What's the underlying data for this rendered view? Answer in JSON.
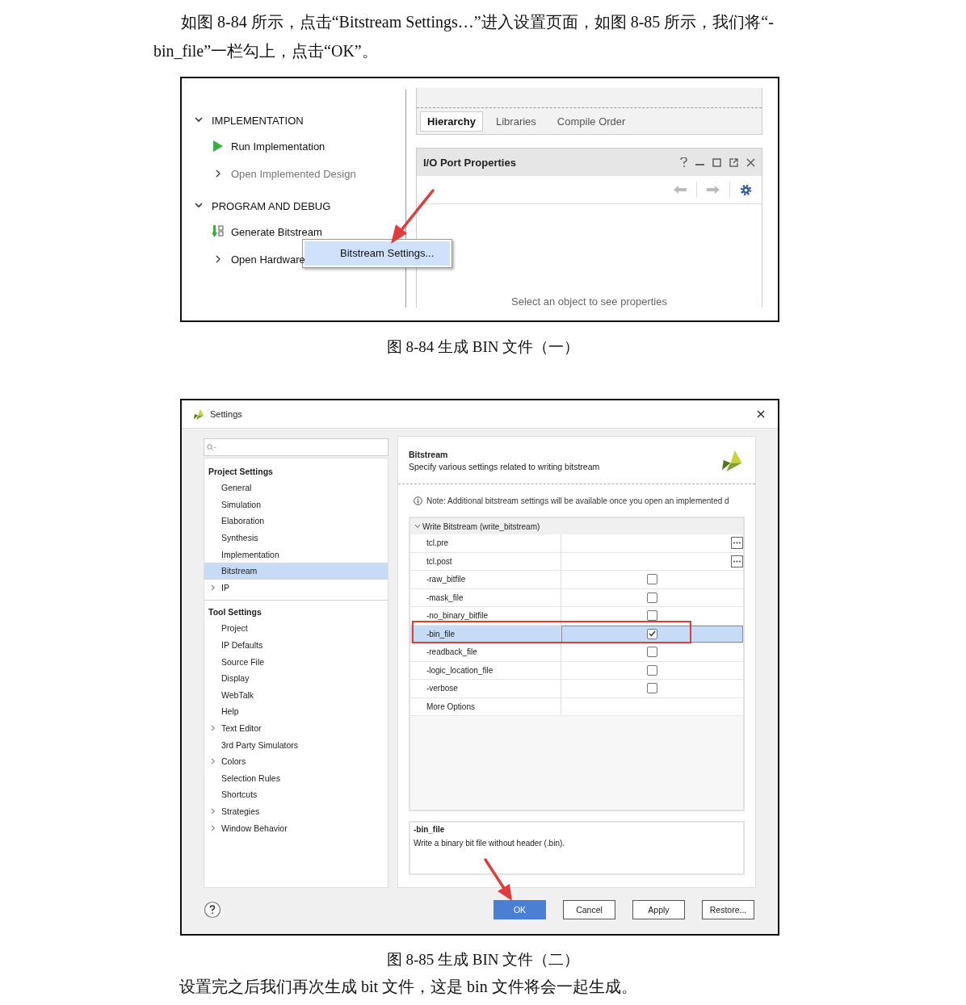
{
  "intro_paragraph": "如图 8-84 所示，点击“Bitstream Settings…”进入设置页面，如图 8-85 所示，我们将“-bin_file”一栏勾上，点击“OK”。",
  "figure_1": {
    "flow_navigator": [
      {
        "title": "IMPLEMENTATION",
        "expanded": true,
        "items": [
          {
            "kind": "run",
            "label": "Run Implementation",
            "disabled": false
          },
          {
            "kind": "open",
            "label": "Open Implemented Design",
            "disabled": true
          }
        ]
      },
      {
        "title": "PROGRAM AND DEBUG",
        "expanded": true,
        "items": [
          {
            "kind": "bitstream",
            "label": "Generate Bitstream",
            "disabled": false
          },
          {
            "kind": "open",
            "label": "Open Hardware",
            "disabled": false
          }
        ]
      }
    ],
    "context_menu": [
      {
        "label": "Bitstream Settings...",
        "selected": true
      }
    ],
    "source_tabs": [
      {
        "label": "Hierarchy",
        "selected": true
      },
      {
        "label": "Libraries",
        "selected": false
      },
      {
        "label": "Compile Order",
        "selected": false
      }
    ],
    "properties_panel": {
      "title": "I/O Port Properties",
      "empty_message": "Select an object to see properties"
    }
  },
  "figure_1_caption": "图 8-84  生成 BIN 文件（一）",
  "figure_2": {
    "title": "Settings",
    "tree_sections": [
      {
        "title": "Project Settings",
        "items": [
          {
            "label": "General",
            "selected": false
          },
          {
            "label": "Simulation",
            "selected": false
          },
          {
            "label": "Elaboration",
            "selected": false
          },
          {
            "label": "Synthesis",
            "selected": false
          },
          {
            "label": "Implementation",
            "selected": false
          },
          {
            "label": "Bitstream",
            "selected": true
          },
          {
            "label": "IP",
            "selected": false,
            "expanded": false
          }
        ]
      },
      {
        "title": "Tool Settings",
        "items": [
          {
            "label": "Project",
            "selected": false
          },
          {
            "label": "IP Defaults",
            "selected": false
          },
          {
            "label": "Source File",
            "selected": false
          },
          {
            "label": "Display",
            "selected": false
          },
          {
            "label": "WebTalk",
            "selected": false
          },
          {
            "label": "Help",
            "selected": false
          },
          {
            "label": "Text Editor",
            "selected": false,
            "expanded": false
          },
          {
            "label": "3rd Party Simulators",
            "selected": false
          },
          {
            "label": "Colors",
            "selected": false,
            "expanded": false
          },
          {
            "label": "Selection Rules",
            "selected": false
          },
          {
            "label": "Shortcuts",
            "selected": false
          },
          {
            "label": "Strategies",
            "selected": false,
            "expanded": false
          },
          {
            "label": "Window Behavior",
            "selected": false,
            "expanded": false
          }
        ]
      }
    ],
    "page": {
      "title": "Bitstream",
      "description": "Specify various settings related to writing bitstream",
      "note": "Note: Additional bitstream settings will be available once you open an implemented d"
    },
    "options_group": {
      "title": "Write Bitstream (write_bitstream)",
      "expanded": true,
      "rows": [
        {
          "kind": "file",
          "name": "tcl.pre",
          "selected": false
        },
        {
          "kind": "file",
          "name": "tcl.post",
          "selected": false
        },
        {
          "kind": "checkbox",
          "name": "-raw_bitfile",
          "checked": false,
          "selected": false
        },
        {
          "kind": "checkbox",
          "name": "-mask_file",
          "checked": false,
          "selected": false
        },
        {
          "kind": "checkbox",
          "name": "-no_binary_bitfile",
          "checked": false,
          "selected": false
        },
        {
          "kind": "checkbox",
          "name": "-bin_file",
          "checked": true,
          "selected": true
        },
        {
          "kind": "checkbox",
          "name": "-readback_file",
          "checked": false,
          "selected": false
        },
        {
          "kind": "checkbox",
          "name": "-logic_location_file",
          "checked": false,
          "selected": false
        },
        {
          "kind": "checkbox",
          "name": "-verbose",
          "checked": false,
          "selected": false
        },
        {
          "kind": "text",
          "name": "More Options",
          "selected": false
        }
      ]
    },
    "help_box": {
      "title": "-bin_file",
      "text": "Write a binary bit file without header (.bin)."
    },
    "buttons": [
      {
        "label": "OK",
        "primary": true
      },
      {
        "label": "Cancel",
        "primary": false
      },
      {
        "label": "Apply",
        "primary": false
      },
      {
        "label": "Restore...",
        "primary": false
      }
    ]
  },
  "figure_2_caption": "图 8-85  生成 BIN 文件（二）",
  "closing_paragraph": "设置完之后我们再次生成 bit 文件，这是 bin 文件将会一起生成。"
}
